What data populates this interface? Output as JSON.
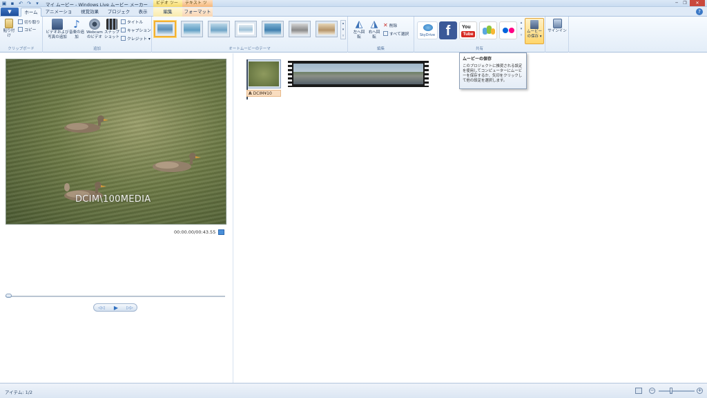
{
  "title_bar": {
    "title": "マイ ムービー - Windows Live ムービー メーカー",
    "context_tab_video": "ビデオ ツール",
    "context_tab_text": "テキスト ツール"
  },
  "tabs": {
    "file_menu": "▼",
    "home": "ホーム",
    "animation": "アニメーション",
    "visual_effects": "視覚効果",
    "project": "プロジェクト",
    "view": "表示",
    "edit": "編集",
    "format": "フォーマット"
  },
  "ribbon": {
    "clipboard": {
      "label": "クリップボード",
      "paste": "貼り付け",
      "cut": "切り取り",
      "copy": "コピー"
    },
    "add": {
      "label": "追加",
      "add_videos_photos": "ビデオおよび写真の追加",
      "add_music": "音楽の追加",
      "webcam_video": "Webcam のビデオ",
      "snapshot": "スナップショット",
      "title": "タイトル",
      "caption": "キャプション",
      "credits": "クレジット"
    },
    "automovie_themes": {
      "label": "オートムービーのテーマ"
    },
    "editing": {
      "label": "編集",
      "rotate_left": "左へ回転",
      "rotate_right": "右へ回転",
      "delete": "削除",
      "select_all": "すべて選択"
    },
    "share": {
      "label": "共有",
      "skydrive": "SkyDrive",
      "save_movie": "ムービーの保存",
      "sign_in": "サインイン"
    }
  },
  "preview": {
    "video_caption": "DCIM\\100MEDIA",
    "timecode": "00:00.00/00:43.55"
  },
  "storyboard": {
    "clip1_label": "DCIM¥10"
  },
  "tooltip": {
    "title": "ムービーの保存",
    "body": "このプロジェクトに推奨される設定を使用してコンピューターにムービーを保存するか、矢印をクリックして他の設定を選択します。"
  },
  "status_bar": {
    "items": "アイテム: 1/2"
  },
  "colors": {
    "accent_blue": "#1f4f9a",
    "facebook": "#3b5998",
    "youtube_red": "#d62a22",
    "flickr_pink": "#ff0084",
    "flickr_blue": "#0063dc",
    "theme_selected": "#f2b134"
  }
}
